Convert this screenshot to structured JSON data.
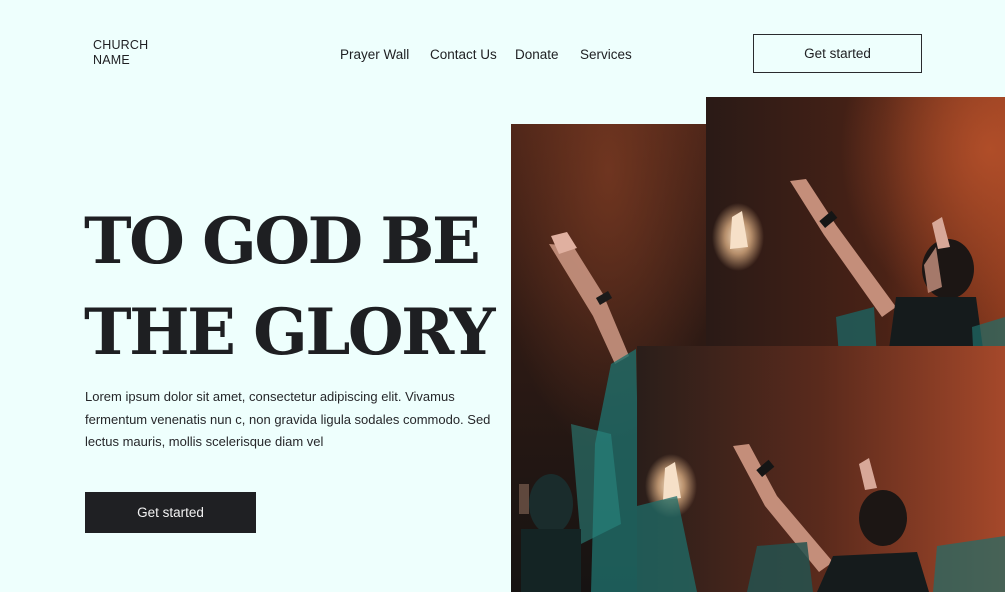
{
  "header": {
    "logo_line1": "CHURCH",
    "logo_line2": "NAME",
    "nav": [
      {
        "label": "Prayer Wall"
      },
      {
        "label": "Contact Us"
      },
      {
        "label": "Donate"
      },
      {
        "label": "Services"
      }
    ],
    "cta_label": "Get started"
  },
  "hero": {
    "title_line1": "TO GOD BE",
    "title_line2": "THE GLORY",
    "description": "Lorem ipsum dolor sit amet, consectetur adipiscing elit. Vivamus fermentum venenatis nun c, non gravida ligula sodales commodo. Sed lectus mauris, mollis scelerisque diam vel",
    "cta_label": "Get started"
  },
  "gallery": {
    "photos": [
      {
        "subject": "worship-crowd-raised-hands"
      },
      {
        "subject": "worship-crowd-raised-hands"
      },
      {
        "subject": "worship-crowd-raised-hands"
      }
    ]
  },
  "colors": {
    "background": "#eefffd",
    "text": "#1e1f22",
    "button_dark": "#1f2023",
    "photo_warm": "#8a3a1e",
    "photo_teal": "#1f6e6a"
  }
}
